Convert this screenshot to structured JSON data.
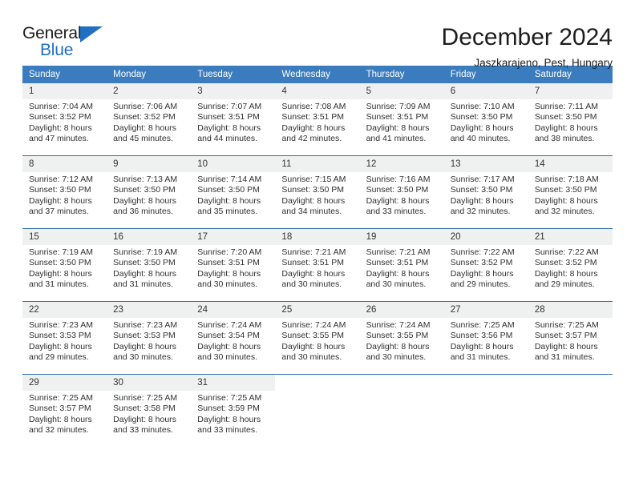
{
  "brand": {
    "name_part1": "General",
    "name_part2": "Blue",
    "flag_icon": "blue-triangle-flag-icon"
  },
  "header": {
    "month_title": "December 2024",
    "location": "Jaszkarajeno, Pest, Hungary"
  },
  "colors": {
    "header_blue": "#3a7cbe",
    "row_divider_blue": "#2f6fad",
    "daynum_background": "#eff0f0",
    "brand_blue": "#1f70c1",
    "text": "#303030"
  },
  "weekday_headers": [
    "Sunday",
    "Monday",
    "Tuesday",
    "Wednesday",
    "Thursday",
    "Friday",
    "Saturday"
  ],
  "weeks": [
    [
      {
        "day": "1",
        "sunrise": "Sunrise: 7:04 AM",
        "sunset": "Sunset: 3:52 PM",
        "daylight_line1": "Daylight: 8 hours",
        "daylight_line2": "and 47 minutes."
      },
      {
        "day": "2",
        "sunrise": "Sunrise: 7:06 AM",
        "sunset": "Sunset: 3:52 PM",
        "daylight_line1": "Daylight: 8 hours",
        "daylight_line2": "and 45 minutes."
      },
      {
        "day": "3",
        "sunrise": "Sunrise: 7:07 AM",
        "sunset": "Sunset: 3:51 PM",
        "daylight_line1": "Daylight: 8 hours",
        "daylight_line2": "and 44 minutes."
      },
      {
        "day": "4",
        "sunrise": "Sunrise: 7:08 AM",
        "sunset": "Sunset: 3:51 PM",
        "daylight_line1": "Daylight: 8 hours",
        "daylight_line2": "and 42 minutes."
      },
      {
        "day": "5",
        "sunrise": "Sunrise: 7:09 AM",
        "sunset": "Sunset: 3:51 PM",
        "daylight_line1": "Daylight: 8 hours",
        "daylight_line2": "and 41 minutes."
      },
      {
        "day": "6",
        "sunrise": "Sunrise: 7:10 AM",
        "sunset": "Sunset: 3:50 PM",
        "daylight_line1": "Daylight: 8 hours",
        "daylight_line2": "and 40 minutes."
      },
      {
        "day": "7",
        "sunrise": "Sunrise: 7:11 AM",
        "sunset": "Sunset: 3:50 PM",
        "daylight_line1": "Daylight: 8 hours",
        "daylight_line2": "and 38 minutes."
      }
    ],
    [
      {
        "day": "8",
        "sunrise": "Sunrise: 7:12 AM",
        "sunset": "Sunset: 3:50 PM",
        "daylight_line1": "Daylight: 8 hours",
        "daylight_line2": "and 37 minutes."
      },
      {
        "day": "9",
        "sunrise": "Sunrise: 7:13 AM",
        "sunset": "Sunset: 3:50 PM",
        "daylight_line1": "Daylight: 8 hours",
        "daylight_line2": "and 36 minutes."
      },
      {
        "day": "10",
        "sunrise": "Sunrise: 7:14 AM",
        "sunset": "Sunset: 3:50 PM",
        "daylight_line1": "Daylight: 8 hours",
        "daylight_line2": "and 35 minutes."
      },
      {
        "day": "11",
        "sunrise": "Sunrise: 7:15 AM",
        "sunset": "Sunset: 3:50 PM",
        "daylight_line1": "Daylight: 8 hours",
        "daylight_line2": "and 34 minutes."
      },
      {
        "day": "12",
        "sunrise": "Sunrise: 7:16 AM",
        "sunset": "Sunset: 3:50 PM",
        "daylight_line1": "Daylight: 8 hours",
        "daylight_line2": "and 33 minutes."
      },
      {
        "day": "13",
        "sunrise": "Sunrise: 7:17 AM",
        "sunset": "Sunset: 3:50 PM",
        "daylight_line1": "Daylight: 8 hours",
        "daylight_line2": "and 32 minutes."
      },
      {
        "day": "14",
        "sunrise": "Sunrise: 7:18 AM",
        "sunset": "Sunset: 3:50 PM",
        "daylight_line1": "Daylight: 8 hours",
        "daylight_line2": "and 32 minutes."
      }
    ],
    [
      {
        "day": "15",
        "sunrise": "Sunrise: 7:19 AM",
        "sunset": "Sunset: 3:50 PM",
        "daylight_line1": "Daylight: 8 hours",
        "daylight_line2": "and 31 minutes."
      },
      {
        "day": "16",
        "sunrise": "Sunrise: 7:19 AM",
        "sunset": "Sunset: 3:50 PM",
        "daylight_line1": "Daylight: 8 hours",
        "daylight_line2": "and 31 minutes."
      },
      {
        "day": "17",
        "sunrise": "Sunrise: 7:20 AM",
        "sunset": "Sunset: 3:51 PM",
        "daylight_line1": "Daylight: 8 hours",
        "daylight_line2": "and 30 minutes."
      },
      {
        "day": "18",
        "sunrise": "Sunrise: 7:21 AM",
        "sunset": "Sunset: 3:51 PM",
        "daylight_line1": "Daylight: 8 hours",
        "daylight_line2": "and 30 minutes."
      },
      {
        "day": "19",
        "sunrise": "Sunrise: 7:21 AM",
        "sunset": "Sunset: 3:51 PM",
        "daylight_line1": "Daylight: 8 hours",
        "daylight_line2": "and 30 minutes."
      },
      {
        "day": "20",
        "sunrise": "Sunrise: 7:22 AM",
        "sunset": "Sunset: 3:52 PM",
        "daylight_line1": "Daylight: 8 hours",
        "daylight_line2": "and 29 minutes."
      },
      {
        "day": "21",
        "sunrise": "Sunrise: 7:22 AM",
        "sunset": "Sunset: 3:52 PM",
        "daylight_line1": "Daylight: 8 hours",
        "daylight_line2": "and 29 minutes."
      }
    ],
    [
      {
        "day": "22",
        "sunrise": "Sunrise: 7:23 AM",
        "sunset": "Sunset: 3:53 PM",
        "daylight_line1": "Daylight: 8 hours",
        "daylight_line2": "and 29 minutes."
      },
      {
        "day": "23",
        "sunrise": "Sunrise: 7:23 AM",
        "sunset": "Sunset: 3:53 PM",
        "daylight_line1": "Daylight: 8 hours",
        "daylight_line2": "and 30 minutes."
      },
      {
        "day": "24",
        "sunrise": "Sunrise: 7:24 AM",
        "sunset": "Sunset: 3:54 PM",
        "daylight_line1": "Daylight: 8 hours",
        "daylight_line2": "and 30 minutes."
      },
      {
        "day": "25",
        "sunrise": "Sunrise: 7:24 AM",
        "sunset": "Sunset: 3:55 PM",
        "daylight_line1": "Daylight: 8 hours",
        "daylight_line2": "and 30 minutes."
      },
      {
        "day": "26",
        "sunrise": "Sunrise: 7:24 AM",
        "sunset": "Sunset: 3:55 PM",
        "daylight_line1": "Daylight: 8 hours",
        "daylight_line2": "and 30 minutes."
      },
      {
        "day": "27",
        "sunrise": "Sunrise: 7:25 AM",
        "sunset": "Sunset: 3:56 PM",
        "daylight_line1": "Daylight: 8 hours",
        "daylight_line2": "and 31 minutes."
      },
      {
        "day": "28",
        "sunrise": "Sunrise: 7:25 AM",
        "sunset": "Sunset: 3:57 PM",
        "daylight_line1": "Daylight: 8 hours",
        "daylight_line2": "and 31 minutes."
      }
    ],
    [
      {
        "day": "29",
        "sunrise": "Sunrise: 7:25 AM",
        "sunset": "Sunset: 3:57 PM",
        "daylight_line1": "Daylight: 8 hours",
        "daylight_line2": "and 32 minutes."
      },
      {
        "day": "30",
        "sunrise": "Sunrise: 7:25 AM",
        "sunset": "Sunset: 3:58 PM",
        "daylight_line1": "Daylight: 8 hours",
        "daylight_line2": "and 33 minutes."
      },
      {
        "day": "31",
        "sunrise": "Sunrise: 7:25 AM",
        "sunset": "Sunset: 3:59 PM",
        "daylight_line1": "Daylight: 8 hours",
        "daylight_line2": "and 33 minutes."
      },
      {
        "day": "",
        "sunrise": "",
        "sunset": "",
        "daylight_line1": "",
        "daylight_line2": ""
      },
      {
        "day": "",
        "sunrise": "",
        "sunset": "",
        "daylight_line1": "",
        "daylight_line2": ""
      },
      {
        "day": "",
        "sunrise": "",
        "sunset": "",
        "daylight_line1": "",
        "daylight_line2": ""
      },
      {
        "day": "",
        "sunrise": "",
        "sunset": "",
        "daylight_line1": "",
        "daylight_line2": ""
      }
    ]
  ]
}
